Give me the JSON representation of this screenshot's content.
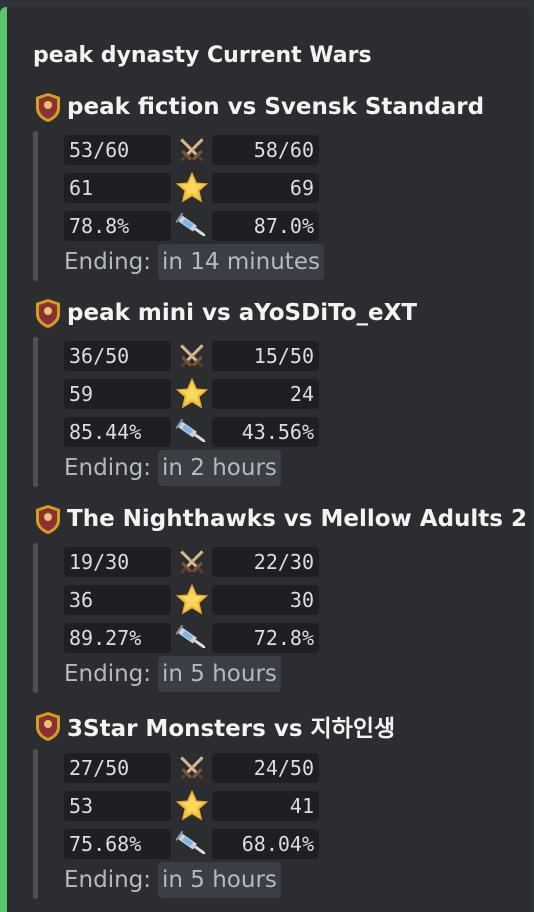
{
  "embed": {
    "title": "peak dynasty Current Wars",
    "accent_color": "#58c76b"
  },
  "labels": {
    "ending": "Ending:"
  },
  "icons": {
    "attacks": "crossed-swords-icon",
    "stars": "star-icon",
    "destruction": "syringe-icon"
  },
  "wars": [
    {
      "name": "peak fiction vs Svensk Standard",
      "badge_icon": "clan-badge-icon",
      "attacks_left": "53/60",
      "attacks_right": "58/60",
      "stars_left": "61",
      "stars_right": "69",
      "destruction_left": "78.8%",
      "destruction_right": "87.0%",
      "ending": "in 14 minutes"
    },
    {
      "name": "peak mini vs aYoSDiTo_eXT",
      "badge_icon": "clan-badge-icon",
      "attacks_left": "36/50",
      "attacks_right": "15/50",
      "stars_left": "59",
      "stars_right": "24",
      "destruction_left": "85.44%",
      "destruction_right": "43.56%",
      "ending": "in 2 hours"
    },
    {
      "name": "The Nighthawks vs Mellow Adults 2",
      "badge_icon": "clan-badge-icon",
      "attacks_left": "19/30",
      "attacks_right": "22/30",
      "stars_left": "36",
      "stars_right": "30",
      "destruction_left": "89.27%",
      "destruction_right": "72.8%",
      "ending": "in 5 hours"
    },
    {
      "name": "3Star Monsters vs 지하인생",
      "badge_icon": "clan-badge-icon",
      "attacks_left": "27/50",
      "attacks_right": "24/50",
      "stars_left": "53",
      "stars_right": "41",
      "destruction_left": "75.68%",
      "destruction_right": "68.04%",
      "ending": "in 5 hours"
    }
  ]
}
